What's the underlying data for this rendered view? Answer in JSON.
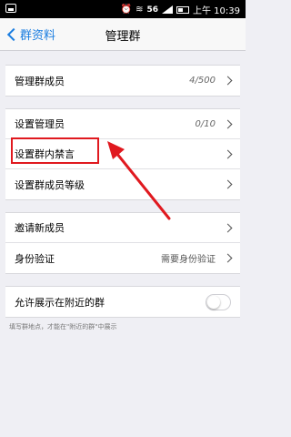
{
  "status_bar": {
    "network": "56",
    "time": "上午 10:39"
  },
  "nav": {
    "back_label": "群资料",
    "title": "管理群"
  },
  "group1": [
    {
      "label": "管理群成员",
      "value": "4/500"
    }
  ],
  "group2": [
    {
      "label": "设置管理员",
      "value": "0/10"
    },
    {
      "label": "设置群内禁言",
      "value": ""
    },
    {
      "label": "设置群成员等级",
      "value": ""
    }
  ],
  "group3": [
    {
      "label": "邀请新成员",
      "value": ""
    },
    {
      "label": "身份验证",
      "value": "需要身份验证"
    }
  ],
  "group4": [
    {
      "label": "允许展示在附近的群",
      "toggle": false
    }
  ],
  "hint": "填写群地点，才能在\"附近的群\"中展示",
  "colors": {
    "accent": "#1a7de0",
    "annotation": "#e0191f",
    "background": "#efeff4"
  }
}
